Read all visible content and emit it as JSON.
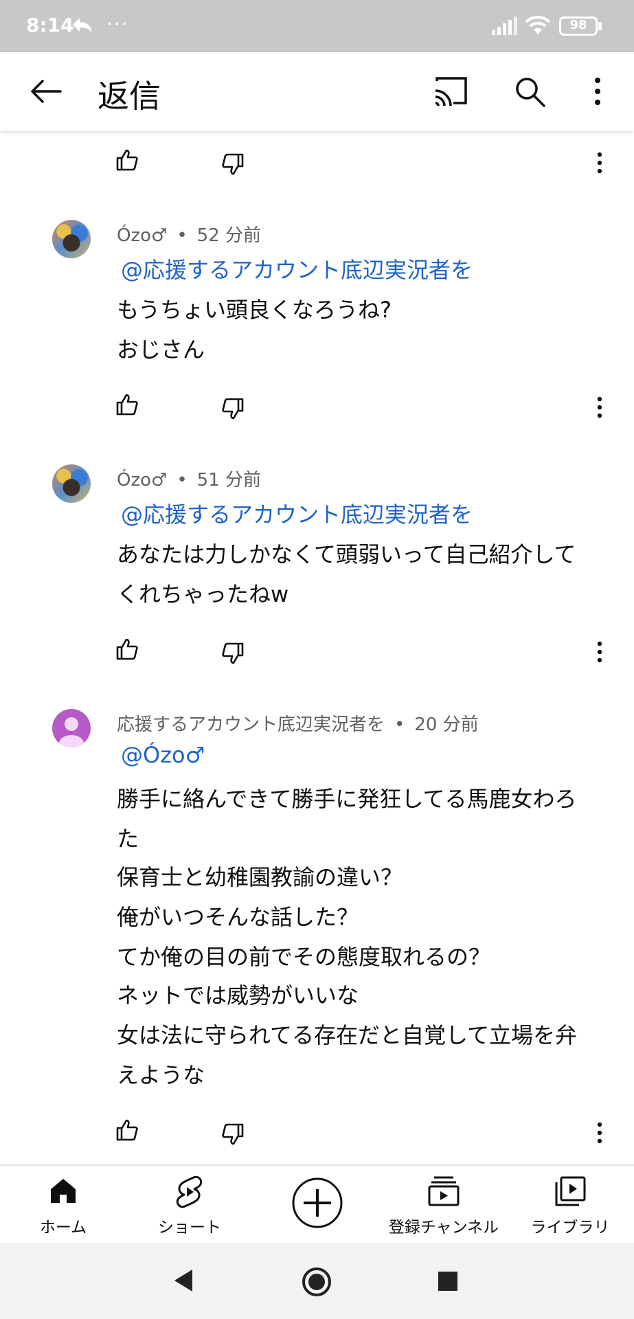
{
  "status_bar": {
    "time": "8:14",
    "battery": "98",
    "icons": [
      "reply-arrow-icon",
      "more-dots-icon",
      "signal-icon",
      "wifi-icon",
      "battery-icon"
    ]
  },
  "app_bar": {
    "title": "返信",
    "icons": [
      "back-arrow-icon",
      "cast-icon",
      "search-icon",
      "more-vert-icon"
    ]
  },
  "comments": [
    {
      "author": "Ózo♂",
      "separator": "•",
      "time": "52 分前",
      "mention": "@応援するアカウント底辺実況者を",
      "lines": [
        "もうちょい頭良くなろうね?",
        "おじさん"
      ]
    },
    {
      "author": "Ózo♂",
      "separator": "•",
      "time": "51 分前",
      "mention": "@応援するアカウント底辺実況者を",
      "lines": [
        "あなたは力しかなくて頭弱いって自己紹介して",
        "くれちゃったねw"
      ]
    },
    {
      "author": "応援するアカウント底辺実況者を",
      "separator": "•",
      "time": "20 分前",
      "mention": "@Ózo♂",
      "lines": [
        "勝手に絡んできて勝手に発狂してる馬鹿女わろ",
        "た",
        "保育士と幼稚園教諭の違い？",
        "俺がいつそんな話した？",
        "てか俺の目の前でその態度取れるの？",
        "ネットでは威勢がいいな",
        "女は法に守られてる存在だと自覚して立場を弁",
        "えような"
      ]
    }
  ],
  "bottom_nav": {
    "home": "ホーム",
    "shorts": "ショート",
    "subscriptions": "登録チャンネル",
    "library": "ライブラリ"
  },
  "colors": {
    "link": "#1e63c7",
    "status_bar": "#c8c8c8",
    "default_avatar": "#b659c9"
  }
}
